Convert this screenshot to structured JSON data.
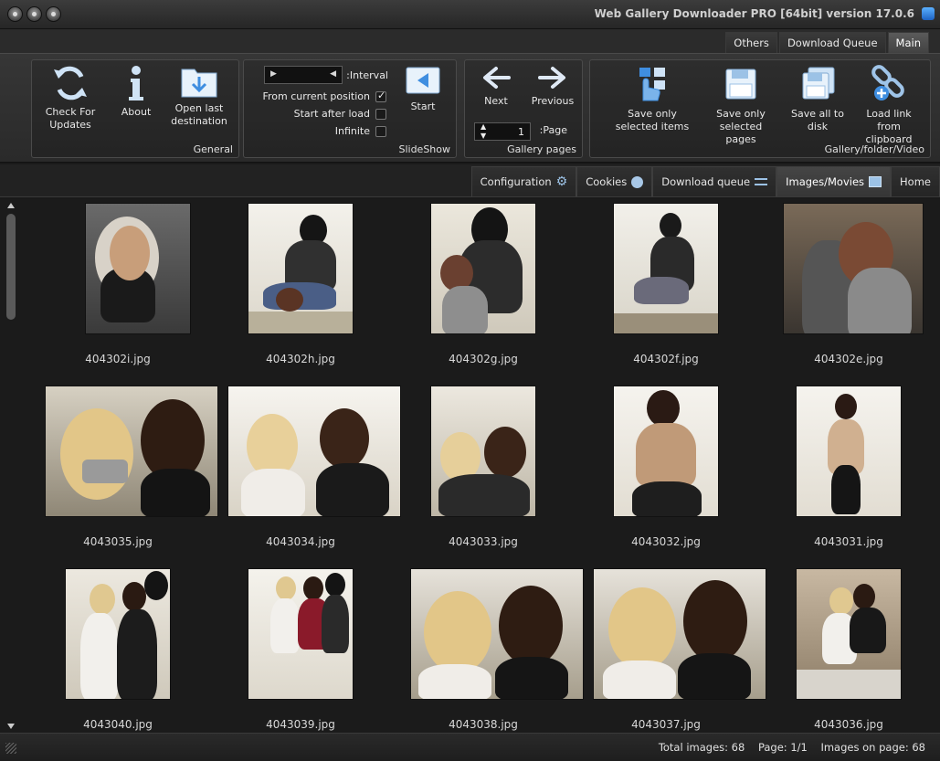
{
  "window": {
    "title": "Web Gallery Downloader PRO [64bit] version 17.0.6"
  },
  "ribbon_tabs": [
    {
      "label": "Main",
      "active": true
    },
    {
      "label": "Download Queue",
      "active": false
    },
    {
      "label": "Others",
      "active": false
    }
  ],
  "groups": {
    "gallery_folder": {
      "label": "Gallery/folder/Video",
      "buttons": [
        {
          "label": "Load link from clipboard",
          "icon": "chain-link-add-icon"
        },
        {
          "label": "Save all to disk",
          "icon": "floppy-disks-icon"
        },
        {
          "label": "Save only selected pages",
          "icon": "floppy-disk-icon"
        },
        {
          "label": "Save only selected items",
          "icon": "hand-select-icon"
        }
      ]
    },
    "gallery_pages": {
      "label": "Gallery pages",
      "previous": "Previous",
      "next": "Next",
      "page_label": "Page:",
      "page_value": "1"
    },
    "slideshow": {
      "label": "SlideShow",
      "start": "Start",
      "interval_label": "Interval:",
      "from_current": "From current position",
      "start_after_load": "Start after load",
      "infinite": "Infinite"
    },
    "general": {
      "label": "General",
      "buttons": [
        {
          "label": "Open last destination",
          "icon": "folder-download-icon"
        },
        {
          "label": "About",
          "icon": "info-icon"
        },
        {
          "label": "Check For Updates",
          "icon": "refresh-icon"
        }
      ]
    }
  },
  "content_tabs": [
    {
      "label": "Home"
    },
    {
      "label": "Images/Movies",
      "active": true
    },
    {
      "label": "Download queue"
    },
    {
      "label": "Cookies"
    },
    {
      "label": "Configuration"
    }
  ],
  "images": [
    "404302e.jpg",
    "404302f.jpg",
    "404302g.jpg",
    "404302h.jpg",
    "404302i.jpg",
    "4043031.jpg",
    "4043032.jpg",
    "4043033.jpg",
    "4043034.jpg",
    "4043035.jpg",
    "4043036.jpg",
    "4043037.jpg",
    "4043038.jpg",
    "4043039.jpg",
    "4043040.jpg"
  ],
  "status": {
    "total_label": "Total images:",
    "total": "68",
    "page_label": "Page:",
    "page": "1/1",
    "on_page_label": "Images on page:",
    "on_page": "68"
  }
}
